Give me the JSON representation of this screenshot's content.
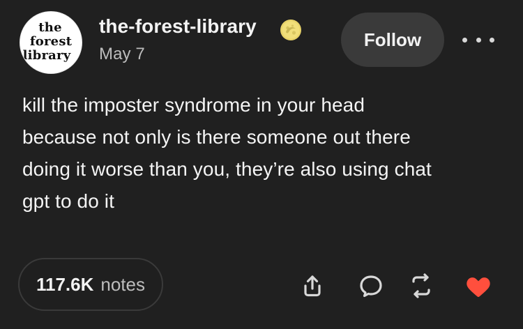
{
  "post": {
    "avatar_lines": [
      "the",
      "forest",
      "library"
    ],
    "blog_name": "the-forest-library",
    "date": "May 7",
    "follow_label": "Follow",
    "text": "kill the imposter syndrome in your head\nbecause not only is there someone out there\ndoing it worse than you, they’re also using chat\ngpt to do it",
    "notes_count": "117.6K",
    "notes_label": "notes"
  },
  "icons": {
    "badge": "verified-badge-icon",
    "more": "more-options-icon",
    "share": "share-icon",
    "reply": "reply-icon",
    "reblog": "reblog-icon",
    "like": "heart-icon"
  },
  "colors": {
    "background": "#202020",
    "pill": "#3a3a3a",
    "like": "#ff4f3d",
    "muted_text": "#bdbdbd"
  }
}
